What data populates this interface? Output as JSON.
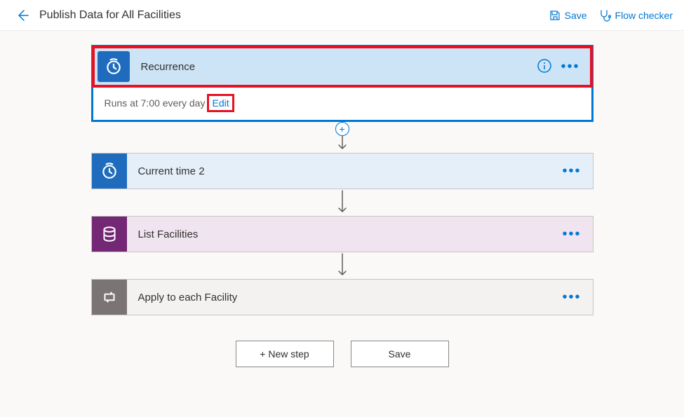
{
  "header": {
    "title": "Publish Data for All Facilities",
    "save_label": "Save",
    "flow_checker_label": "Flow checker"
  },
  "steps": {
    "recurrence": {
      "title": "Recurrence",
      "schedule_text": "Runs at 7:00 every day",
      "edit_label": "Edit"
    },
    "current_time": {
      "title": "Current time 2"
    },
    "list_facilities": {
      "title": "List Facilities"
    },
    "apply_each": {
      "title": "Apply to each Facility"
    }
  },
  "footer": {
    "new_step_label": "+ New step",
    "save_label": "Save"
  }
}
